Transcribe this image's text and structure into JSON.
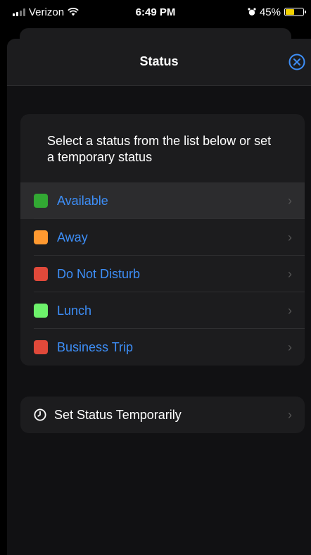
{
  "status_bar": {
    "carrier": "Verizon",
    "time": "6:49 PM",
    "battery_percent": "45%",
    "battery_level": 0.45,
    "battery_color": "#f2d100"
  },
  "nav": {
    "title": "Status",
    "close_icon": "close-circle-icon",
    "accent": "#3d8ef7"
  },
  "status_list": {
    "prompt": "Select a status from the list below or set a temporary status",
    "items": [
      {
        "label": "Available",
        "color": "#32a833",
        "selected": true
      },
      {
        "label": "Away",
        "color": "#ff9930"
      },
      {
        "label": "Do Not Disturb",
        "color": "#e0493a"
      },
      {
        "label": "Lunch",
        "color": "#6df26b"
      },
      {
        "label": "Business Trip",
        "color": "#e0493a"
      }
    ]
  },
  "temporary": {
    "label": "Set Status Temporarily",
    "icon": "clock-icon"
  }
}
